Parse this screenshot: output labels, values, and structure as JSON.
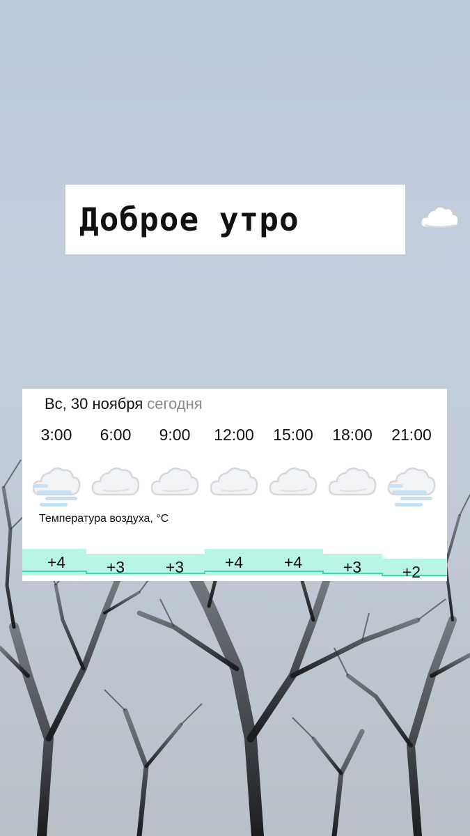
{
  "greeting": {
    "text": "Доброе утро",
    "icon": "cloud-icon"
  },
  "forecast": {
    "date": "Вс, 30 ноября",
    "today_label": "сегодня",
    "temperature_caption": "Температура воздуха, °C",
    "accent_color": "#b8f5e6",
    "line_color": "#3ed6ad",
    "slots": [
      {
        "time": "3:00",
        "icon": "fog-cloud-icon",
        "temp": "+4",
        "value": 4
      },
      {
        "time": "6:00",
        "icon": "cloud-icon",
        "temp": "+3",
        "value": 3
      },
      {
        "time": "9:00",
        "icon": "cloud-icon",
        "temp": "+3",
        "value": 3
      },
      {
        "time": "12:00",
        "icon": "cloud-icon",
        "temp": "+4",
        "value": 4
      },
      {
        "time": "15:00",
        "icon": "cloud-icon",
        "temp": "+4",
        "value": 4
      },
      {
        "time": "18:00",
        "icon": "cloud-icon",
        "temp": "+3",
        "value": 3
      },
      {
        "time": "21:00",
        "icon": "fog-cloud-icon",
        "temp": "+2",
        "value": 2
      }
    ]
  }
}
